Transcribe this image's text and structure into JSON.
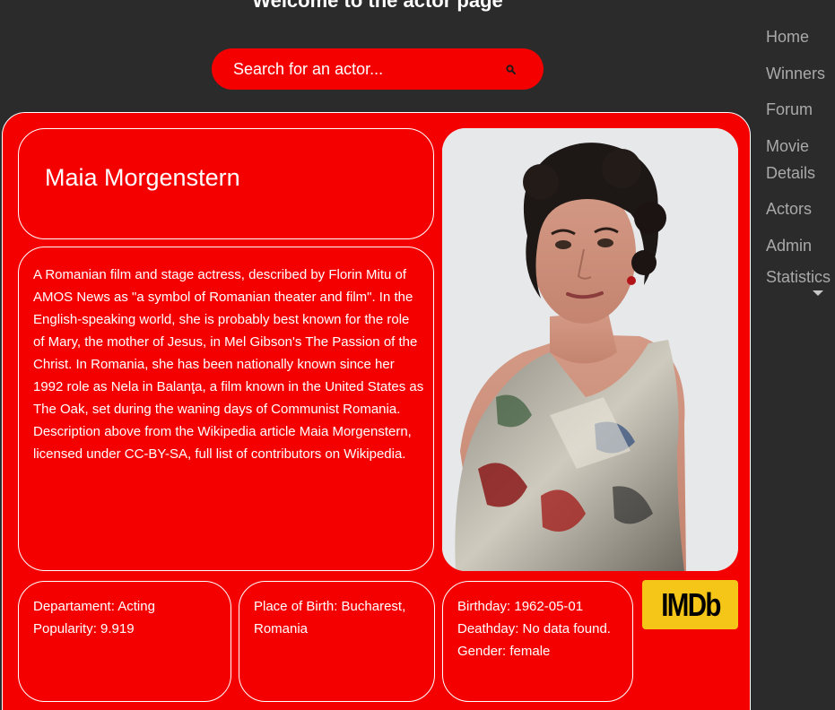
{
  "header": {
    "title": "Welcome to the actor page"
  },
  "search": {
    "placeholder": "Search for an actor...",
    "icon": "search-icon"
  },
  "nav": {
    "home": "Home",
    "winners": "Winners",
    "forum": "Forum",
    "movie_details": "Movie Details",
    "actors": "Actors",
    "admin": "Admin",
    "statistics": "Statistics"
  },
  "actor": {
    "name": "Maia Morgenstern",
    "biography": "A Romanian film and stage actress,  described by Florin Mitu of AMOS News as \"a symbol of Romanian theater and film\". In the English-speaking world, she is probably best known for the role of Mary, the mother of Jesus, in Mel Gibson's The Passion of the Christ. In Romania, she has been nationally known since her 1992 role as Nela in Balanţa, a film known in the United States as The Oak, set during the waning days of Communist Romania. Description above from the Wikipedia article Maia Morgenstern, licensed under CC-BY-SA, full list of contributors on Wikipedia.",
    "department": "Departament: Acting",
    "popularity": "Popularity: 9.919",
    "place_of_birth": "Place of Birth: Bucharest, Romania",
    "birthday": "Birthday: 1962-05-01",
    "deathday": "Deathday: No data found.",
    "gender": "Gender: female"
  },
  "imdb": {
    "label": "IMDb"
  },
  "colors": {
    "background": "#2b2b2b",
    "accent_red": "#f40000",
    "nav_text": "#a9a9a9",
    "imdb_yellow": "#f5c518"
  }
}
